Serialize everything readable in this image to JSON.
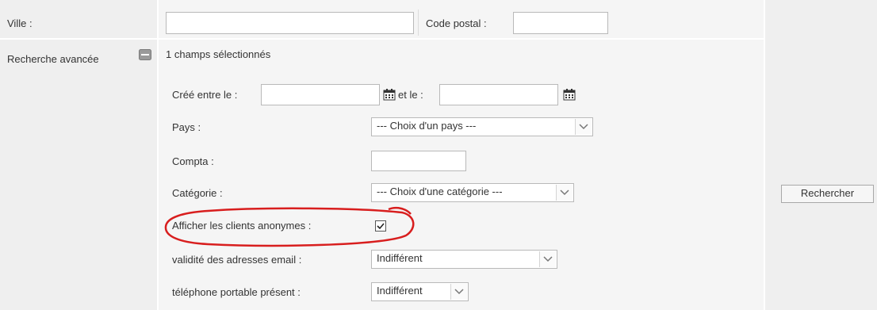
{
  "form": {
    "ville_label": "Ville :",
    "ville_value": "",
    "code_postal_label": "Code postal :",
    "code_postal_value": "",
    "advanced_label": "Recherche avancée",
    "selected_count": "1 champs sélectionnés",
    "cree_entre_label": "Créé entre le :",
    "cree_start_value": "",
    "et_le_label": "et le :",
    "cree_end_value": "",
    "pays_label": "Pays :",
    "pays_value": "--- Choix d'un pays ---",
    "compta_label": "Compta :",
    "compta_value": "",
    "categorie_label": "Catégorie :",
    "categorie_value": "--- Choix d'une catégorie ---",
    "anonymes_label": "Afficher les clients anonymes :",
    "anonymes_checked": true,
    "email_label": "validité des adresses email :",
    "email_value": "Indifférent",
    "portable_label": "téléphone portable présent :",
    "portable_value": "Indifférent",
    "search_button": "Rechercher"
  },
  "icons": {
    "calendar": "calendar-icon",
    "collapse": "collapse-toggle-icon",
    "dropdown": "chevron-down-icon",
    "check": "check-icon"
  },
  "colors": {
    "annotation": "#d81e1e",
    "label_bg": "#efefef",
    "value_bg": "#f5f5f5"
  }
}
